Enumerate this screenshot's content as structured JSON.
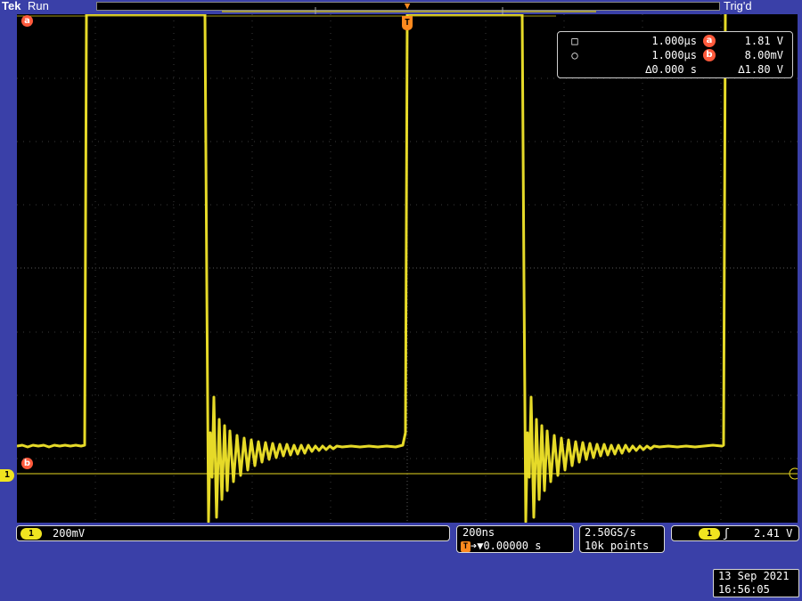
{
  "header": {
    "brand": "Tek",
    "run_state": "Run",
    "trigger_state": "Trig'd"
  },
  "markers": {
    "cursor_a": "a",
    "cursor_b": "b",
    "channel": "1",
    "trigger": "T"
  },
  "cursor_readout": {
    "row1": {
      "time": "1.000µs",
      "label": "a",
      "value": "1.81 V"
    },
    "row2": {
      "time": "1.000µs",
      "label": "b",
      "value": "8.00mV"
    },
    "row3": {
      "delta_time": "∆0.000 s",
      "delta_value": "∆1.80 V"
    }
  },
  "channel_panel": {
    "channel": "1",
    "scale": "200mV"
  },
  "timebase_panel": {
    "scale": "200ns",
    "trigger_pos": "➔▼0.00000 s"
  },
  "acquisition_panel": {
    "rate": "2.50GS/s",
    "record": "10k points"
  },
  "trigger_panel": {
    "channel": "1",
    "slope": "ʃ",
    "level": "2.41 V"
  },
  "datetime": {
    "date": "13 Sep  2021",
    "time": "16:56:05"
  },
  "colors": {
    "trace": "#f0e420",
    "background": "#000000",
    "frame": "#3a40a8",
    "cursor_badge": "#ff5a3c",
    "trigger": "#ff8a1e"
  }
}
